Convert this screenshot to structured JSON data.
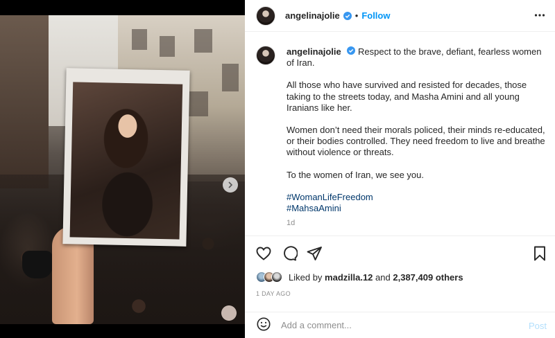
{
  "post": {
    "username": "angelinajolie",
    "follow_label": "Follow",
    "separator": "•"
  },
  "caption": {
    "username": "angelinajolie",
    "first_line": "Respect to the brave, defiant, fearless women of Iran.",
    "paragraph_2": "All those who have survived and resisted for decades, those taking to the streets today, and Masha Amini and all young Iranians like her.",
    "paragraph_3": "Women don’t need their morals policed, their minds re-educated, or their bodies controlled. They need freedom to live and breathe without violence or threats.",
    "paragraph_4": "To the women of Iran, we see you.",
    "hashtags": [
      "#WomanLifeFreedom",
      "#MahsaAmini"
    ],
    "age": "1d"
  },
  "likes": {
    "prefix": "Liked by",
    "first_user": "madzilla.12",
    "joiner": "and",
    "others": "2,387,409 others"
  },
  "timestamp": "1 DAY AGO",
  "comment": {
    "placeholder": "Add a comment...",
    "post_label": "Post"
  },
  "carousel": {
    "count": 7,
    "active_index": 0
  },
  "colors": {
    "accent": "#0095f6",
    "verified": "#3897f0",
    "muted": "#8e8e8e",
    "hashtag": "#00376b",
    "post_disabled": "#b2dffc"
  },
  "icons": {
    "verified": "verified-badge-icon",
    "more": "more-options-icon",
    "like": "heart-icon",
    "comment": "comment-icon",
    "share": "send-icon",
    "save": "bookmark-icon",
    "emoji": "emoji-icon",
    "next": "chevron-right-icon"
  }
}
